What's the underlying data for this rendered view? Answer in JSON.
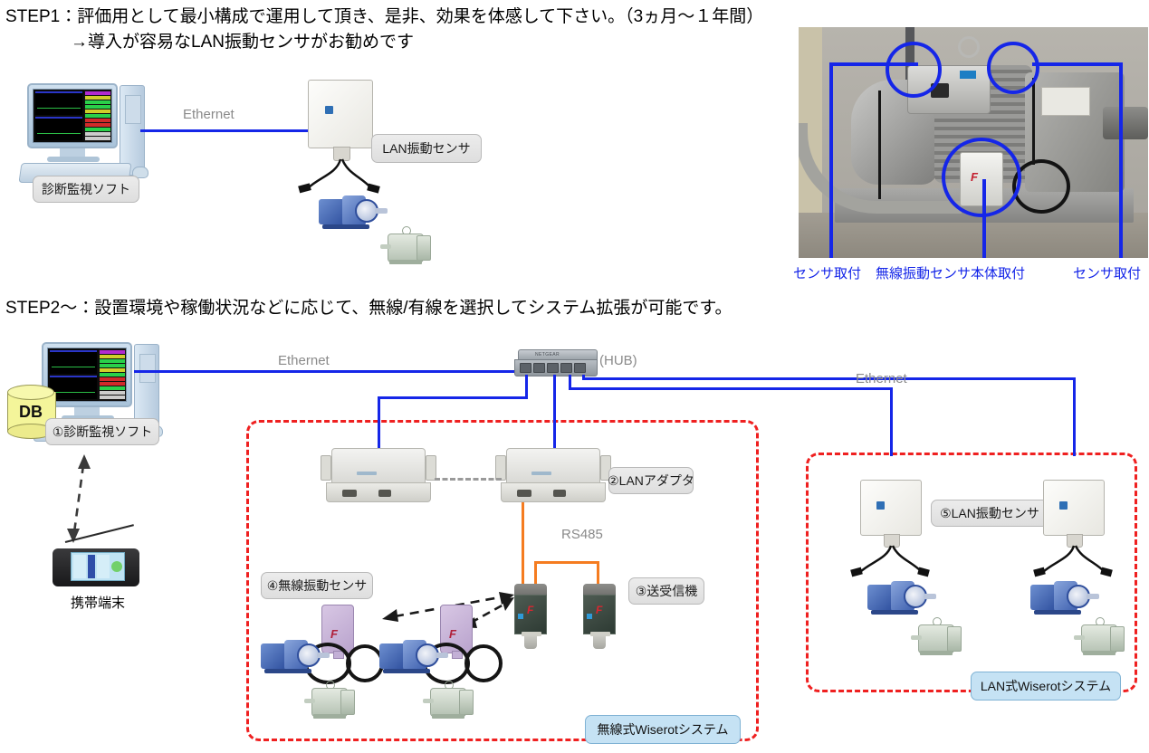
{
  "headings": {
    "step1_line1": "STEP1：評価用として最小構成で運用して頂き、是非、効果を体感して下さい。（3ヵ月〜１年間）",
    "step1_line2": "→導入が容易なLAN振動センサがお勧めです",
    "step2": "STEP2〜：設置環境や稼働状況などに応じて、無線/有線を選択してシステム拡張が可能です。"
  },
  "step1_diagram": {
    "pc_label": "診断監視ソフト",
    "ethernet_label": "Ethernet",
    "sensor_label": "LAN振動センサ"
  },
  "photo": {
    "callouts": [
      {
        "text": "センサ取付"
      },
      {
        "text": "無線振動センサ本体取付"
      },
      {
        "text": "センサ取付"
      }
    ]
  },
  "step2_diagram": {
    "pc_label": "①診断監視ソフト",
    "db_label": "DB",
    "mobile_label": "携帯端末",
    "ethernet_left": "Ethernet",
    "ethernet_right": "Ethernet",
    "hub_label": "(HUB)",
    "adapter_label": "②LANアダプタ",
    "rs485_label": "RS485",
    "transceiver_label": "③送受信機",
    "wireless_sensor_label": "④無線振動センサ",
    "lan_sensor_label": "⑤LAN振動センサ",
    "wireless_system_label": "無線式Wiserotシステム",
    "lan_system_label": "LAN式Wiserotシステム"
  },
  "colors": {
    "ethernet_blue": "#1526e8",
    "rs485_orange": "#f57c20",
    "zone_red": "#ef2020",
    "annotation_blue": "#1526e8",
    "label_gray": "#e4e4e4",
    "label_blue": "#c5e2f4"
  }
}
